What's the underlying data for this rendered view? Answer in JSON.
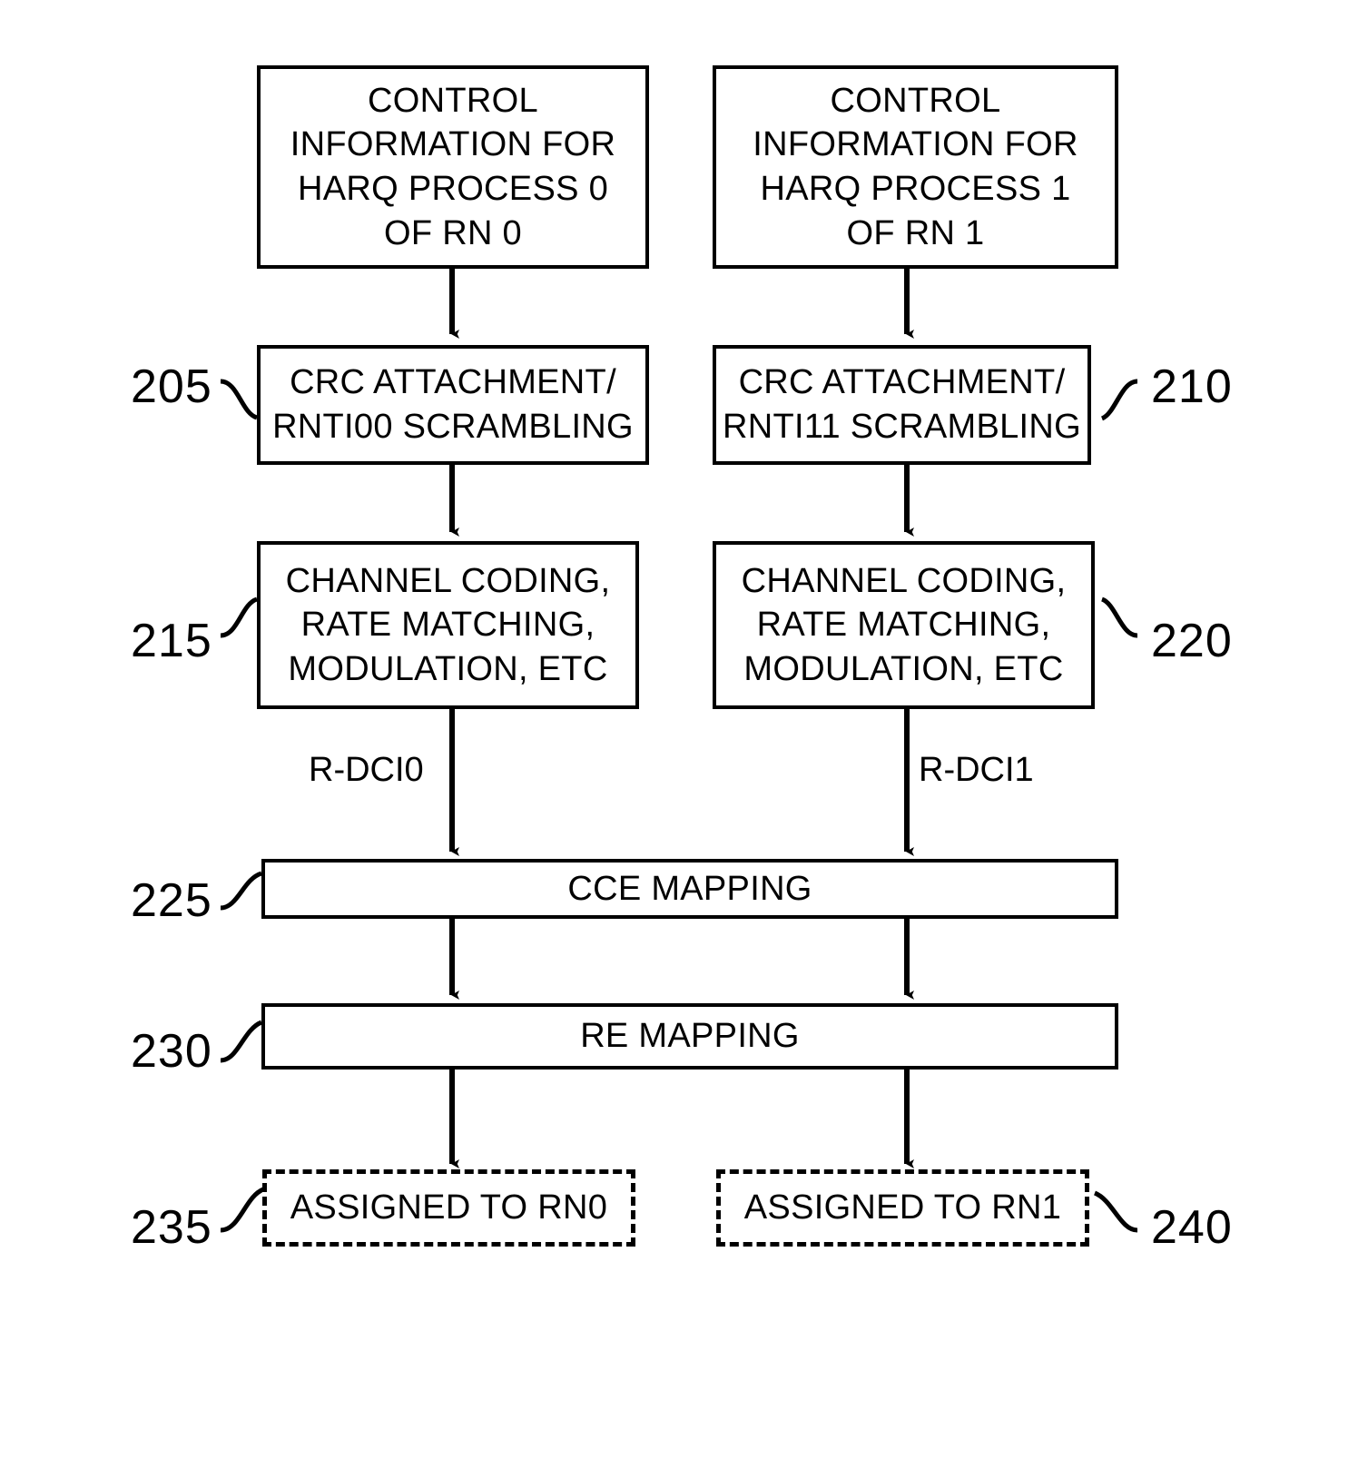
{
  "figure": {
    "type": "patent-flowchart",
    "background": "#ffffff",
    "stroke": "#000000"
  },
  "boxes": {
    "control_info_0": {
      "label": "CONTROL\nINFORMATION FOR\nHARQ PROCESS 0\nOF RN 0",
      "style": "solid"
    },
    "control_info_1": {
      "label": "CONTROL\nINFORMATION FOR\nHARQ PROCESS 1\nOF RN 1",
      "style": "solid"
    },
    "crc_0": {
      "label": "CRC ATTACHMENT/\nRNTI00 SCRAMBLING",
      "style": "solid"
    },
    "crc_1": {
      "label": "CRC ATTACHMENT/\nRNTI11 SCRAMBLING",
      "style": "solid"
    },
    "coding_0": {
      "label": "CHANNEL CODING,\nRATE MATCHING,\nMODULATION, ETC",
      "style": "solid"
    },
    "coding_1": {
      "label": "CHANNEL CODING,\nRATE MATCHING,\nMODULATION, ETC",
      "style": "solid"
    },
    "cce_mapping": {
      "label": "CCE MAPPING",
      "style": "solid"
    },
    "re_mapping": {
      "label": "RE MAPPING",
      "style": "solid"
    },
    "assigned_rn0": {
      "label": "ASSIGNED TO RN0",
      "style": "dashed"
    },
    "assigned_rn1": {
      "label": "ASSIGNED TO RN1",
      "style": "dashed"
    }
  },
  "reference_numerals": {
    "crc_0": "205",
    "crc_1": "210",
    "coding_0": "215",
    "coding_1": "220",
    "cce_mapping": "225",
    "re_mapping": "230",
    "assigned_rn0": "235",
    "assigned_rn1": "240"
  },
  "edge_labels": {
    "dci_left": "R-DCI0",
    "dci_right": "R-DCI1"
  }
}
